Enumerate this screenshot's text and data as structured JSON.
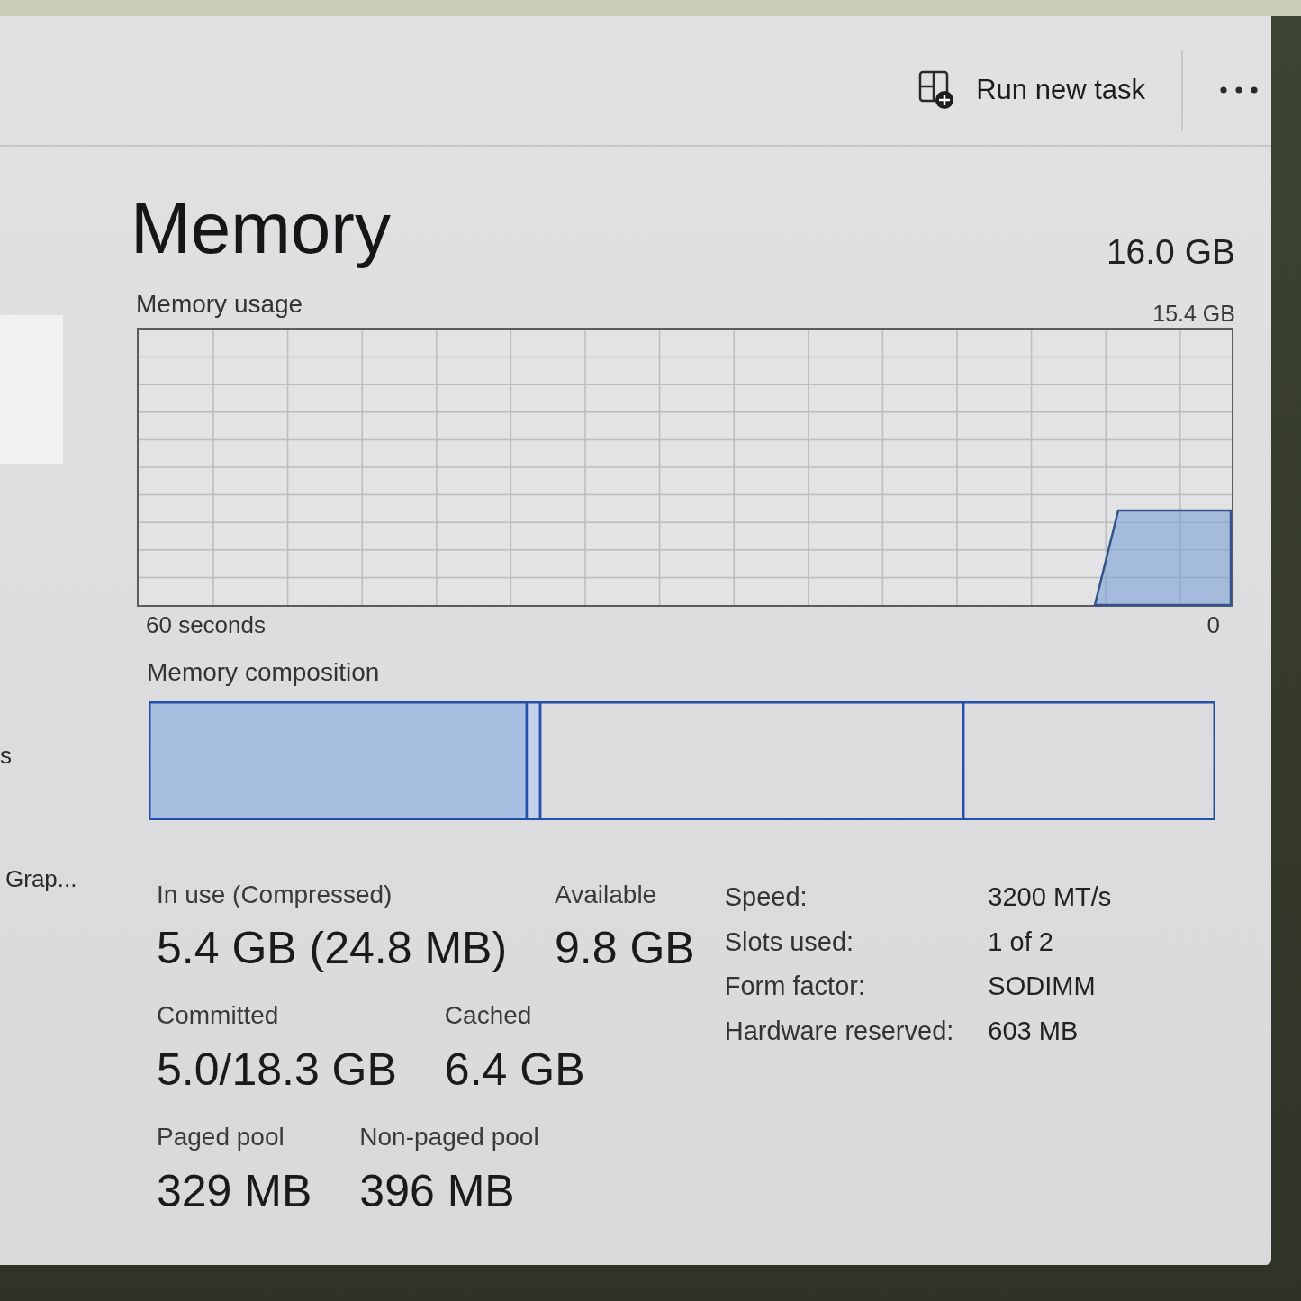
{
  "toolbar": {
    "run_new_task": {
      "label": "Run new task"
    }
  },
  "sidebar": {
    "items": [
      {
        "selected": true
      },
      {
        "label": "s",
        "selected": false
      },
      {
        "label": "Grap...",
        "selected": false
      }
    ]
  },
  "header": {
    "title": "Memory",
    "total": "16.0 GB"
  },
  "usage_graph": {
    "label": "Memory usage",
    "max_label": "15.4 GB",
    "start_label": "60 seconds",
    "end_label": "0"
  },
  "composition": {
    "label": "Memory composition"
  },
  "stat_rows": [
    {
      "stats": [
        {
          "label": "In use (Compressed)",
          "value": "5.4 GB (24.8 MB)"
        },
        {
          "label": "Available",
          "value": "9.8 GB"
        }
      ]
    },
    {
      "stats": [
        {
          "label": "Committed",
          "value": "5.0/18.3 GB"
        },
        {
          "label": "Cached",
          "value": "6.4 GB"
        }
      ]
    },
    {
      "stats": [
        {
          "label": "Paged pool",
          "value": "329 MB"
        },
        {
          "label": "Non-paged pool",
          "value": "396 MB"
        }
      ]
    }
  ],
  "details": [
    {
      "label": "Speed:",
      "value": "3200 MT/s"
    },
    {
      "label": "Slots used:",
      "value": "1 of 2"
    },
    {
      "label": "Form factor:",
      "value": "SODIMM"
    },
    {
      "label": "Hardware reserved:",
      "value": "603 MB"
    }
  ]
}
